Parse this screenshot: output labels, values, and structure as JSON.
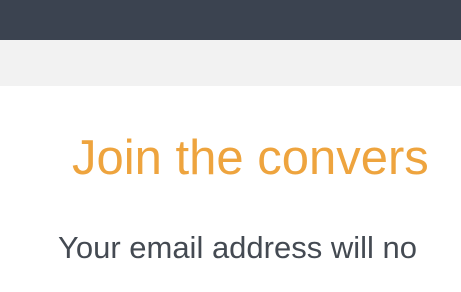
{
  "comment_section": {
    "heading": "Join the convers",
    "email_note": "Your email address will no"
  },
  "colors": {
    "top_bar": "#3b4350",
    "sub_bar": "#f2f2f2",
    "heading": "#eea43e",
    "note_text": "#444a52"
  }
}
